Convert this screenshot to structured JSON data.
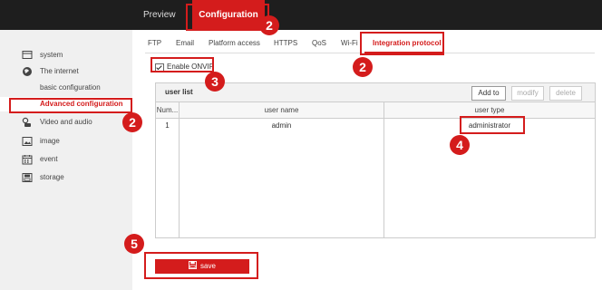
{
  "topnav": {
    "preview": "Preview",
    "configuration": "Configuration"
  },
  "sidebar": {
    "items": [
      {
        "label": "system",
        "icon": "monitor-icon"
      },
      {
        "label": "The internet",
        "icon": "globe-icon"
      },
      {
        "label": "basic configuration",
        "icon": ""
      },
      {
        "label": "Advanced configuration",
        "icon": ""
      },
      {
        "label": "Video and audio",
        "icon": "camera-icon"
      },
      {
        "label": "image",
        "icon": "image-icon"
      },
      {
        "label": "event",
        "icon": "calendar-icon"
      },
      {
        "label": "storage",
        "icon": "disk-icon"
      }
    ]
  },
  "subtabs": [
    "FTP",
    "Email",
    "Platform access",
    "HTTPS",
    "QoS",
    "Wi-Fi",
    "Integration protocol"
  ],
  "onvif": {
    "label": "Enable ONVIF",
    "checked": true
  },
  "userlist": {
    "title": "user list",
    "buttons": {
      "add": "Add to",
      "modify": "modify",
      "delete": "delete"
    },
    "columns": {
      "num": "Num...",
      "name": "user name",
      "type": "user type"
    },
    "rows": [
      {
        "num": "1",
        "name": "admin",
        "type": "administrator"
      }
    ]
  },
  "save": {
    "label": "save",
    "icon": "save-icon"
  },
  "callouts": [
    "2",
    "2",
    "3",
    "2",
    "4",
    "5"
  ],
  "colors": {
    "accent": "#d41c1c",
    "topbar": "#1e1e1e",
    "sidebar": "#f0f0f0"
  }
}
